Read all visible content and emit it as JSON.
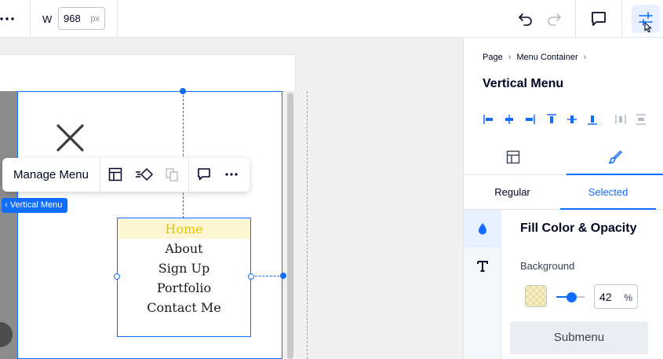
{
  "toolbar": {
    "width_label": "W",
    "width_value": "968",
    "width_unit": "px",
    "icons": [
      "more-icon",
      "undo-icon",
      "redo-icon",
      "comment-icon",
      "settings-sliders-icon"
    ]
  },
  "canvas": {
    "menu_items": [
      "Home",
      "About",
      "Sign Up",
      "Portfolio",
      "Contact Me"
    ],
    "active_item": "Home",
    "element_tag": "Vertical Menu",
    "floating_toolbar": {
      "manage_label": "Manage Menu",
      "icons": [
        "layout-icon",
        "animation-icon",
        "duplicate-icon",
        "comment-icon",
        "more-icon"
      ]
    }
  },
  "panel": {
    "breadcrumbs": [
      "Page",
      "Menu Container"
    ],
    "title": "Vertical Menu",
    "tabs": [
      "layout-tab",
      "design-tab"
    ],
    "state_tabs": [
      "Regular",
      "Selected"
    ],
    "selected_state": "Selected",
    "section_title": "Fill Color & Opacity",
    "background_label": "Background",
    "opacity_value": "42",
    "opacity_unit": "%",
    "submenu_label": "Submenu"
  },
  "colors": {
    "accent": "#116dff",
    "active_item_text": "#e6c200",
    "active_item_bg": "#fdf6d5"
  }
}
